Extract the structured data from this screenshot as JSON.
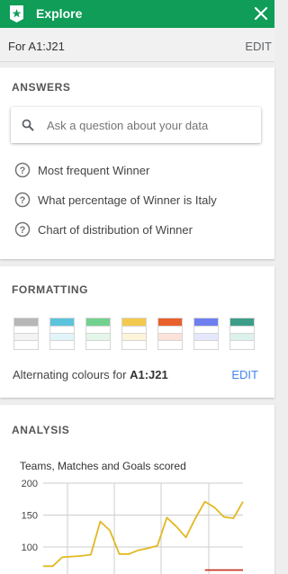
{
  "header": {
    "title": "Explore",
    "logo_icon": "explore-icon",
    "close_icon": "close-icon",
    "color": "#0f9d58"
  },
  "range": {
    "label": "For A1:J21",
    "edit": "EDIT"
  },
  "answers": {
    "title": "ANSWERS",
    "search": {
      "placeholder": "Ask a question about your data",
      "value": ""
    },
    "suggestions": [
      {
        "text": "Most frequent Winner"
      },
      {
        "text": "What percentage of Winner is Italy"
      },
      {
        "text": "Chart of distribution of Winner"
      }
    ]
  },
  "formatting": {
    "title": "FORMATTING",
    "swatches": [
      {
        "header": "#b7b7b7",
        "band": "#f3f3f3"
      },
      {
        "header": "#5bc4dc",
        "band": "#e0f5fa"
      },
      {
        "header": "#72d18f",
        "band": "#e3f6e9"
      },
      {
        "header": "#f2c94c",
        "band": "#fdf5d9"
      },
      {
        "header": "#e8602c",
        "band": "#fce2d8"
      },
      {
        "header": "#6f7ff0",
        "band": "#e5e8fd"
      },
      {
        "header": "#3c9e88",
        "band": "#dcf1ec"
      }
    ],
    "alt_label_prefix": "Alternating colours for ",
    "alt_label_range": "A1:J21",
    "edit": "EDIT"
  },
  "analysis": {
    "title": "ANALYSIS",
    "chart_data": {
      "type": "line",
      "title": "Teams, Matches and Goals scored",
      "ylim": [
        75,
        200
      ],
      "yticks": [
        "200",
        "150",
        "100"
      ],
      "grid": true,
      "series": [
        {
          "color": "#e2b821",
          "values": [
            70,
            70,
            84,
            85,
            86,
            88,
            140,
            126,
            89,
            89,
            95,
            98,
            102,
            146,
            132,
            115,
            145,
            171,
            162,
            147,
            145,
            171
          ]
        },
        {
          "color": "#c53929",
          "values": [
            null,
            null,
            null,
            null,
            null,
            null,
            null,
            null,
            null,
            null,
            null,
            null,
            null,
            null,
            null,
            null,
            null,
            64,
            64,
            64,
            64,
            64
          ]
        }
      ]
    }
  }
}
